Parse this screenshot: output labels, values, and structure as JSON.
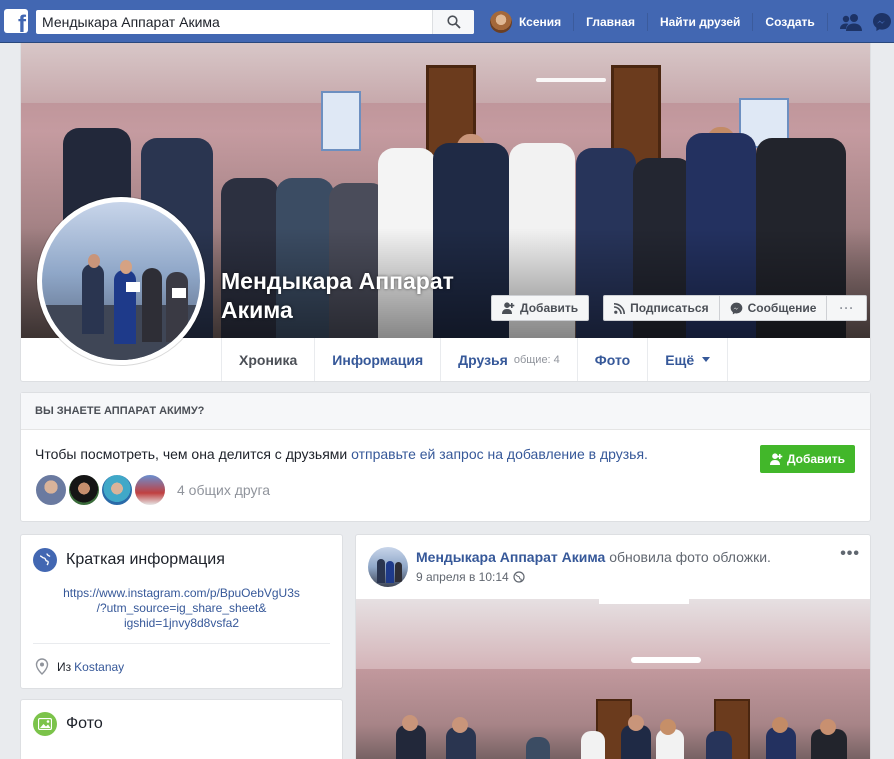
{
  "topbar": {
    "logo": "f",
    "search_value": "Мендыкара Аппарат Акима",
    "user_name": "Ксения",
    "nav": [
      "Главная",
      "Найти друзей",
      "Создать"
    ],
    "icons": [
      "friends-icon",
      "messenger-icon",
      "notifications-icon"
    ]
  },
  "profile": {
    "name": "Мендыкара Аппарат Акима",
    "buttons": {
      "add": "Добавить",
      "follow": "Подписаться",
      "message": "Сообщение",
      "more": "···"
    },
    "tabs": [
      {
        "label": "Хроника"
      },
      {
        "label": "Информация"
      },
      {
        "label": "Друзья",
        "sub": "общие: 4"
      },
      {
        "label": "Фото"
      },
      {
        "label": "Ещё"
      }
    ]
  },
  "know": {
    "header": "ВЫ ЗНАЕТЕ АППАРАТ АКИМУ?",
    "text": "Чтобы посмотреть, чем она делится с друзьями",
    "link": "отправьте ей запрос на добавление в друзья.",
    "add_button": "Добавить",
    "mutual": "4 общих друга"
  },
  "intro": {
    "title": "Краткая информация",
    "link_lines": [
      "https://www.instagram.com/p/BpuOebVgU3s",
      "/?utm_source=ig_share_sheet&",
      "igshid=1jnvy8d8vsfa2"
    ],
    "location_prefix": "Из",
    "location": "Kostanay"
  },
  "photos": {
    "title": "Фото"
  },
  "post": {
    "author": "Мендыкара Аппарат Акима",
    "action": "обновила фото обложки.",
    "date": "9 апреля в 10:14",
    "more": "•••"
  },
  "colors": {
    "brand": "#4267b2",
    "link": "#365899",
    "green": "#42b72a"
  }
}
